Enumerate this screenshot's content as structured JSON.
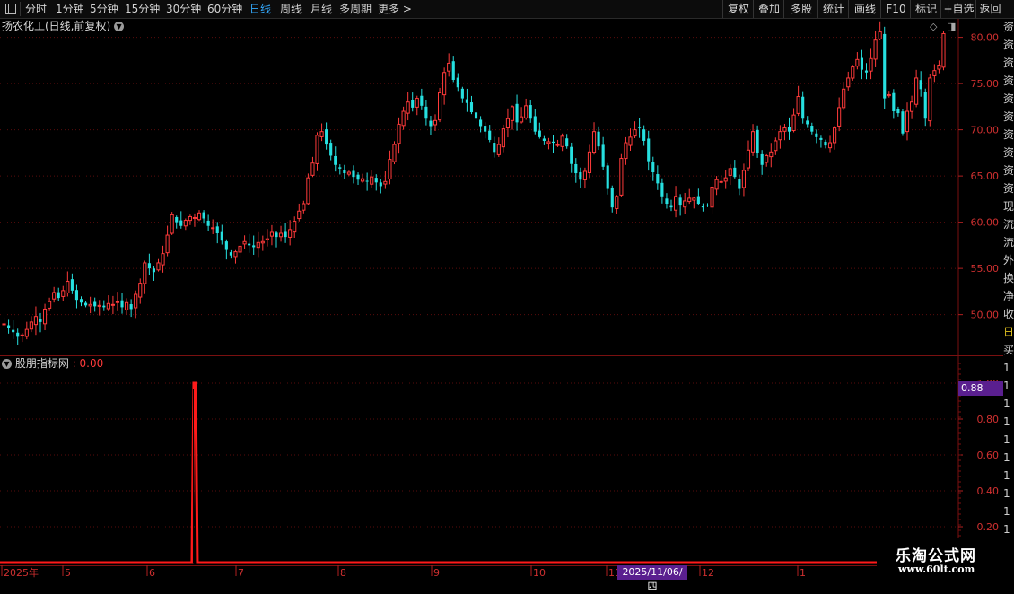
{
  "toolbar": {
    "periods": [
      "分时",
      "1分钟",
      "5分钟",
      "15分钟",
      "30分钟",
      "60分钟",
      "日线",
      "周线",
      "月线",
      "多周期",
      "更多 >"
    ],
    "active_period": "日线",
    "right_buttons": [
      "复权",
      "叠加",
      "多股",
      "统计",
      "画线",
      "F10",
      "标记",
      "+自选",
      "返回"
    ]
  },
  "main_chart": {
    "title": "扬农化工(日线,前复权)",
    "y_ticks": [
      "80.00",
      "75.00",
      "70.00",
      "65.00",
      "60.00",
      "55.00",
      "50.00"
    ]
  },
  "sub_chart": {
    "title": "股朋指标网",
    "value_text": ": 0.00",
    "y_ticks": [
      "1.00",
      "0.80",
      "0.60",
      "0.40",
      "0.20"
    ],
    "cursor_value": "0.88"
  },
  "x_axis": {
    "labels": [
      "2025年",
      "5",
      "6",
      "7",
      "8",
      "9",
      "10",
      "11",
      "12",
      "1"
    ],
    "cursor_date": "2025/11/06/四"
  },
  "sidebar_chars": [
    "资",
    "资",
    "资",
    "资",
    "资",
    "资",
    "资",
    "资",
    "资",
    "资",
    "现",
    "流",
    "流",
    "外",
    "换",
    "净",
    "收",
    "日",
    "买",
    "1",
    "1",
    "1",
    "1",
    "1",
    "1",
    "1",
    "1",
    "1",
    "1"
  ],
  "watermark": {
    "line1": "乐淘公式网",
    "line2": "www.60lt.com"
  },
  "colors": {
    "up": "#ff3a3a",
    "down": "#26e0e0",
    "axis": "#d03030",
    "highlight": "#5a1f8f"
  },
  "chart_data": [
    {
      "type": "candlestick",
      "title": "扬农化工(日线,前复权)",
      "ylim": [
        45.5,
        82.0
      ],
      "x_month_labels": [
        "2025年",
        "5",
        "6",
        "7",
        "8",
        "9",
        "10",
        "11",
        "12",
        "1"
      ],
      "closes": [
        49.0,
        48.6,
        48.1,
        47.6,
        47.8,
        48.4,
        49.2,
        49.8,
        49.2,
        50.6,
        51.4,
        52.4,
        51.8,
        52.6,
        53.6,
        52.6,
        51.6,
        51.3,
        51.0,
        51.1,
        50.9,
        51.0,
        50.8,
        51.2,
        51.1,
        51.4,
        50.8,
        51.3,
        50.6,
        52.2,
        53.4,
        55.6,
        55.0,
        54.6,
        55.6,
        56.6,
        58.6,
        60.8,
        60.0,
        59.6,
        60.2,
        60.6,
        60.5,
        61.0,
        60.4,
        59.6,
        59.4,
        58.8,
        58.0,
        57.0,
        56.4,
        56.8,
        57.4,
        57.9,
        57.5,
        57.3,
        57.8,
        57.9,
        58.2,
        58.9,
        58.4,
        58.8,
        58.4,
        59.2,
        60.1,
        61.2,
        62.0,
        64.8,
        66.4,
        69.4,
        69.8,
        68.4,
        67.2,
        66.2,
        65.8,
        65.3,
        65.4,
        64.9,
        64.6,
        64.7,
        64.4,
        64.9,
        64.3,
        63.9,
        64.4,
        66.8,
        68.4,
        70.6,
        72.0,
        73.0,
        72.4,
        73.4,
        72.6,
        71.2,
        70.4,
        71.0,
        74.0,
        76.2,
        77.2,
        75.4,
        74.6,
        73.4,
        72.9,
        71.9,
        71.2,
        70.4,
        69.8,
        68.9,
        67.6,
        68.4,
        70.1,
        71.2,
        72.5,
        70.8,
        71.4,
        72.6,
        71.2,
        69.8,
        69.2,
        68.8,
        68.7,
        68.6,
        68.4,
        69.3,
        68.2,
        66.3,
        65.3,
        64.6,
        65.5,
        67.6,
        69.8,
        68.2,
        66.0,
        63.6,
        61.6,
        62.8,
        66.9,
        68.6,
        69.2,
        70.0,
        70.2,
        68.8,
        66.6,
        65.4,
        64.2,
        62.8,
        62.0,
        61.6,
        62.8,
        61.8,
        62.3,
        62.6,
        62.6,
        62.0,
        61.6,
        61.8,
        63.8,
        64.6,
        64.4,
        64.8,
        65.8,
        64.9,
        63.6,
        65.6,
        67.8,
        69.8,
        67.5,
        66.2,
        67.2,
        67.6,
        68.8,
        69.8,
        70.2,
        69.8,
        71.6,
        73.6,
        71.2,
        70.6,
        69.8,
        69.2,
        68.9,
        68.3,
        68.6,
        70.2,
        72.4,
        74.4,
        75.6,
        76.8,
        77.6,
        76.5,
        76.2,
        77.7,
        79.7,
        80.6,
        73.4,
        73.8,
        72.0,
        71.8,
        69.6,
        72.0,
        73.0,
        75.6,
        74.4,
        71.2,
        75.6,
        76.4,
        77.0,
        80.4
      ]
    },
    {
      "type": "line",
      "title": "股朋指标网",
      "ylim": [
        0,
        1.05
      ],
      "spike_index": 42,
      "spike_value": 1.0,
      "baseline_value": 0.0
    }
  ]
}
